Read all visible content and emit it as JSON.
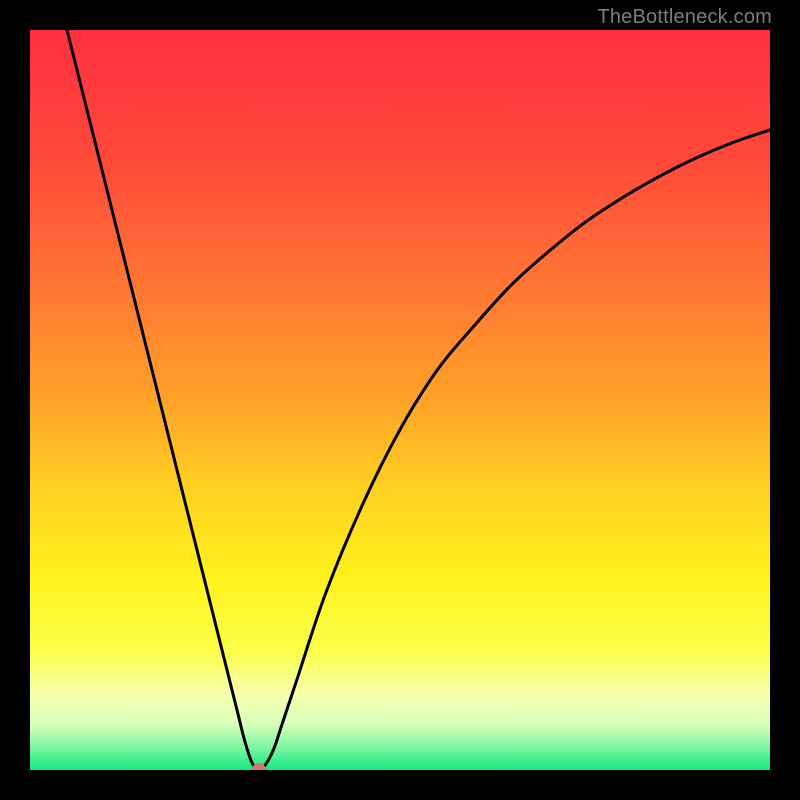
{
  "watermark": "TheBottleneck.com",
  "colors": {
    "black": "#000000",
    "curve": "#000000",
    "dot": "#cf7a6f",
    "gradient_stops": [
      {
        "offset": 0.0,
        "color": "#ff2f3f"
      },
      {
        "offset": 0.18,
        "color": "#ff4a3a"
      },
      {
        "offset": 0.36,
        "color": "#ff7a32"
      },
      {
        "offset": 0.5,
        "color": "#ffa228"
      },
      {
        "offset": 0.62,
        "color": "#ffd020"
      },
      {
        "offset": 0.74,
        "color": "#fff21c"
      },
      {
        "offset": 0.84,
        "color": "#fcff4a"
      },
      {
        "offset": 0.9,
        "color": "#f6ffb0"
      },
      {
        "offset": 0.94,
        "color": "#d4ffb8"
      },
      {
        "offset": 0.97,
        "color": "#78f7a0"
      },
      {
        "offset": 1.0,
        "color": "#18e780"
      }
    ]
  },
  "chart_data": {
    "type": "line",
    "title": "",
    "xlabel": "",
    "ylabel": "",
    "xlim": [
      0,
      100
    ],
    "ylim": [
      0,
      100
    ],
    "grid": false,
    "series": [
      {
        "name": "bottleneck-curve",
        "x": [
          5,
          10,
          15,
          20,
          25,
          26,
          27,
          28,
          29,
          30,
          31,
          32,
          33,
          34,
          36,
          40,
          45,
          50,
          55,
          60,
          65,
          70,
          75,
          80,
          85,
          90,
          95,
          100
        ],
        "y": [
          100,
          80,
          60,
          40,
          20,
          16,
          12,
          8,
          4,
          1,
          0,
          1,
          3,
          6,
          12,
          24,
          36,
          46,
          54,
          60,
          65.5,
          70,
          74,
          77.3,
          80.2,
          82.7,
          84.8,
          86.5
        ]
      }
    ],
    "marker": {
      "x": 31,
      "y": 0,
      "name": "optimal-point"
    },
    "annotations": []
  }
}
